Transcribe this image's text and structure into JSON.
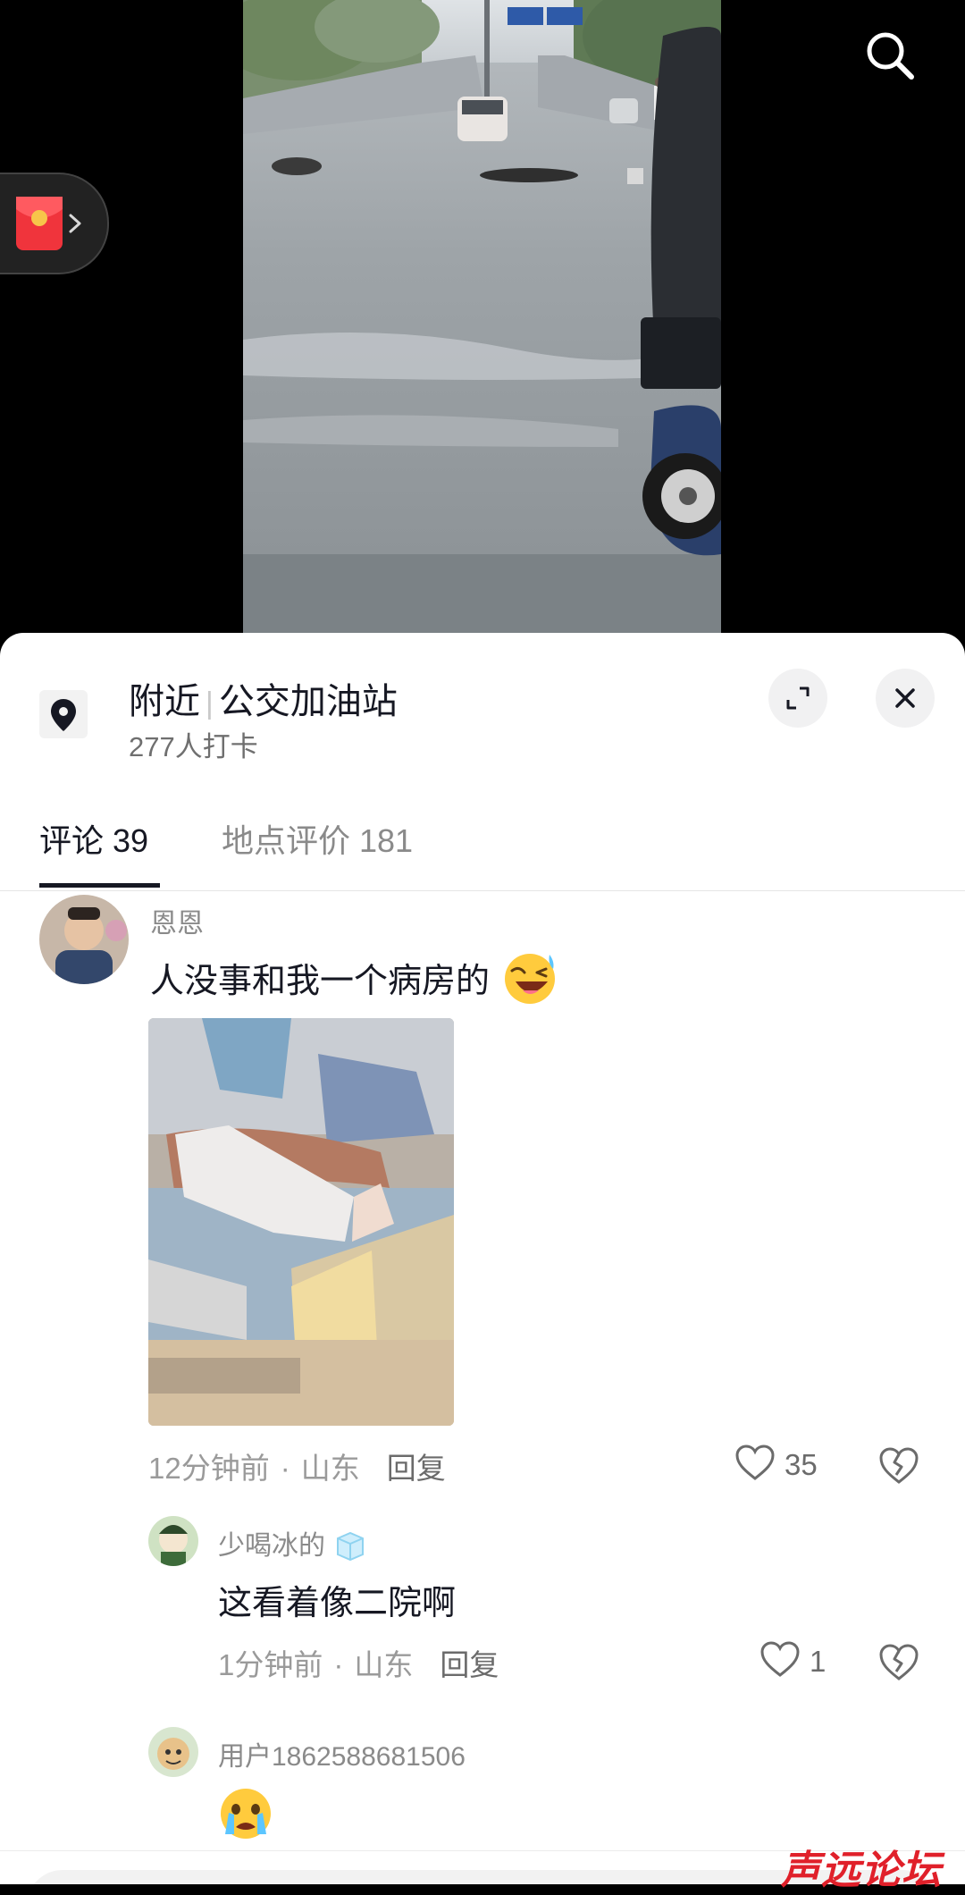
{
  "location": {
    "scope": "附近",
    "name": "公交加油站",
    "checkins": "277人打卡"
  },
  "tabs": [
    {
      "label": "评论 39",
      "active": true
    },
    {
      "label": "地点评价 181",
      "active": false
    }
  ],
  "comments": [
    {
      "username": "恩恩",
      "text": "人没事和我一个病房的",
      "has_emoji": true,
      "has_image": true,
      "time": "12分钟前",
      "region": "山东",
      "reply_label": "回复",
      "likes": "35"
    },
    {
      "username": "少喝冰的",
      "text": "这看着像二院啊",
      "time": "1分钟前",
      "region": "山东",
      "reply_label": "回复",
      "likes": "1"
    },
    {
      "username": "用户1862588681506",
      "text": ""
    }
  ],
  "dot_separator": "·",
  "watermark": "声远论坛",
  "colors": {
    "text_primary": "#161823",
    "text_secondary": "#8a8a8a",
    "watermark": "#e0202a"
  },
  "icons": [
    "search-icon",
    "red-packet-icon",
    "chevron-right-icon",
    "location-pin-icon",
    "expand-icon",
    "close-icon",
    "heart-icon",
    "broken-heart-icon"
  ]
}
